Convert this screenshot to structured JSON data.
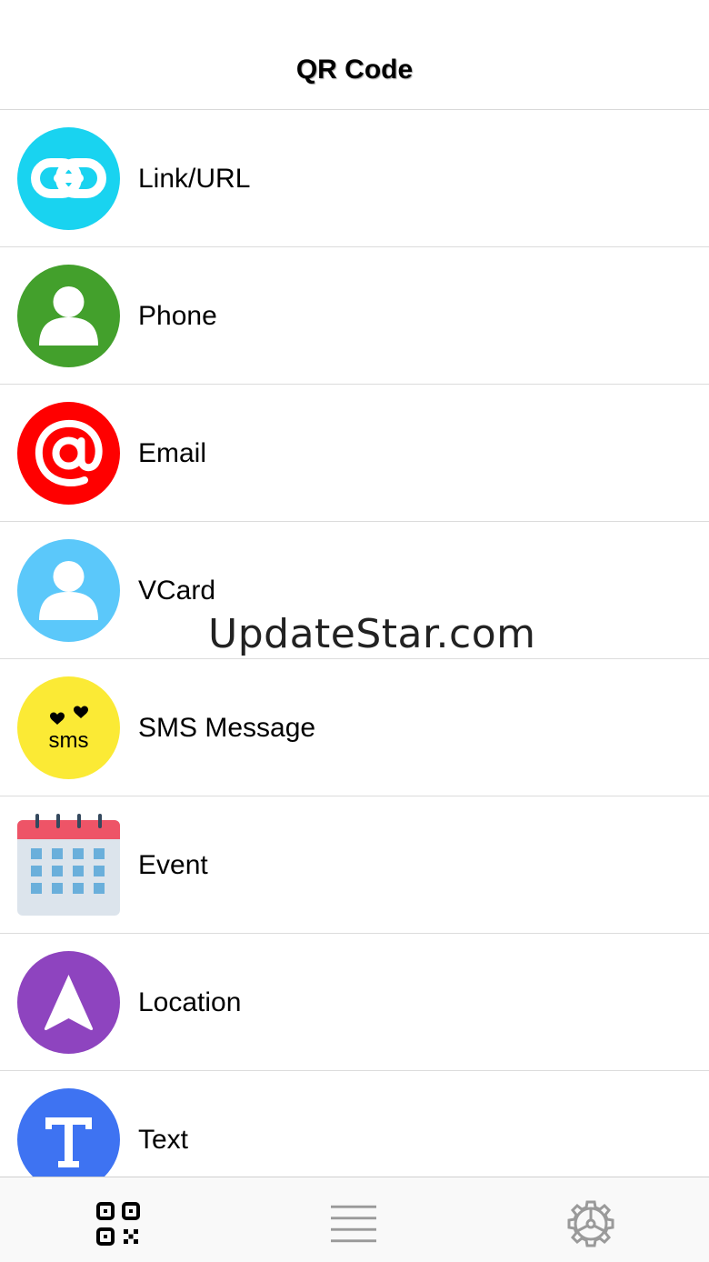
{
  "nav": {
    "title": "QR Code"
  },
  "items": [
    {
      "label": "Link/URL",
      "icon": "link-icon",
      "color": "#19D3F0"
    },
    {
      "label": "Phone",
      "icon": "person-icon",
      "color": "#43A02C"
    },
    {
      "label": "Email",
      "icon": "at-sign-icon",
      "color": "#FF0000"
    },
    {
      "label": "VCard",
      "icon": "person-icon",
      "color": "#5BC8FA"
    },
    {
      "label": "SMS Message",
      "icon": "sms-icon",
      "color": "#FBEA35",
      "icon_text": "sms"
    },
    {
      "label": "Event",
      "icon": "calendar-icon",
      "color": "#EE5467"
    },
    {
      "label": "Location",
      "icon": "navigation-arrow-icon",
      "color": "#8E44BF"
    },
    {
      "label": "Text",
      "icon": "letter-t-icon",
      "color": "#3E73F2"
    }
  ],
  "watermark": "UpdateStar.com",
  "tabbar": {
    "tabs": [
      {
        "icon": "qr-code-icon",
        "active": true
      },
      {
        "icon": "list-icon",
        "active": false
      },
      {
        "icon": "settings-icon",
        "active": false
      }
    ]
  }
}
